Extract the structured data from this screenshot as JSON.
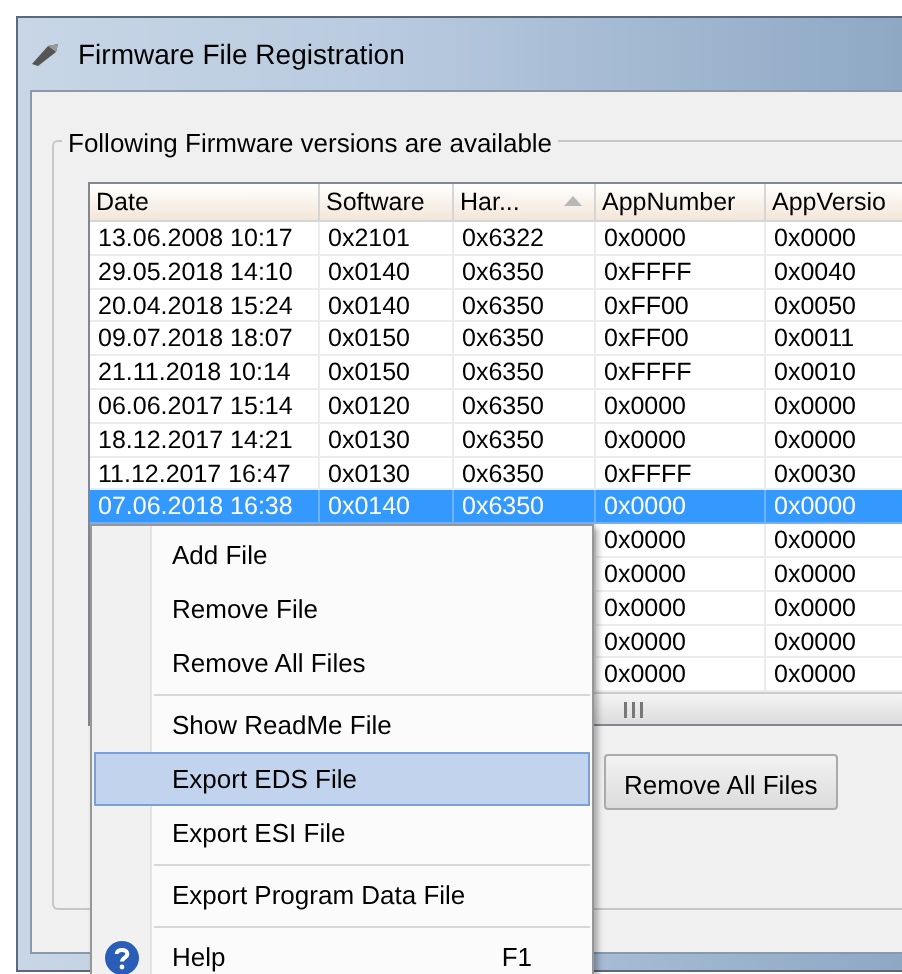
{
  "window": {
    "title": "Firmware File Registration"
  },
  "group": {
    "label": "Following Firmware versions are available"
  },
  "table": {
    "columns": [
      {
        "label": "Date",
        "sorted": false
      },
      {
        "label": "Software",
        "sorted": false
      },
      {
        "label": "Har...",
        "sorted": true
      },
      {
        "label": "AppNumber",
        "sorted": false
      },
      {
        "label": "AppVersio",
        "sorted": false
      }
    ],
    "rows": [
      {
        "selected": false,
        "cells": [
          "13.06.2008 10:17",
          "0x2101",
          "0x6322",
          "0x0000",
          "0x0000"
        ]
      },
      {
        "selected": false,
        "cells": [
          "29.05.2018 14:10",
          "0x0140",
          "0x6350",
          "0xFFFF",
          "0x0040"
        ]
      },
      {
        "selected": false,
        "cells": [
          "20.04.2018 15:24",
          "0x0140",
          "0x6350",
          "0xFF00",
          "0x0050"
        ]
      },
      {
        "selected": false,
        "cells": [
          "09.07.2018 18:07",
          "0x0150",
          "0x6350",
          "0xFF00",
          "0x0011"
        ]
      },
      {
        "selected": false,
        "cells": [
          "21.11.2018 10:14",
          "0x0150",
          "0x6350",
          "0xFFFF",
          "0x0010"
        ]
      },
      {
        "selected": false,
        "cells": [
          "06.06.2017 15:14",
          "0x0120",
          "0x6350",
          "0x0000",
          "0x0000"
        ]
      },
      {
        "selected": false,
        "cells": [
          "18.12.2017 14:21",
          "0x0130",
          "0x6350",
          "0x0000",
          "0x0000"
        ]
      },
      {
        "selected": false,
        "cells": [
          "11.12.2017 16:47",
          "0x0130",
          "0x6350",
          "0xFFFF",
          "0x0030"
        ]
      },
      {
        "selected": true,
        "cells": [
          "07.06.2018 16:38",
          "0x0140",
          "0x6350",
          "0x0000",
          "0x0000"
        ]
      },
      {
        "selected": false,
        "cells": [
          null,
          null,
          null,
          "0x0000",
          "0x0000"
        ]
      },
      {
        "selected": false,
        "cells": [
          null,
          null,
          null,
          "0x0000",
          "0x0000"
        ]
      },
      {
        "selected": false,
        "cells": [
          null,
          null,
          null,
          "0x0000",
          "0x0000"
        ]
      },
      {
        "selected": false,
        "cells": [
          null,
          null,
          null,
          "0x0000",
          "0x0000"
        ]
      },
      {
        "selected": false,
        "cells": [
          null,
          null,
          null,
          "0x0000",
          "0x0000"
        ]
      }
    ]
  },
  "buttons": [
    {
      "label": "Remove All Files"
    }
  ],
  "context_menu": [
    {
      "kind": "item",
      "label": "Add File",
      "highlighted": false
    },
    {
      "kind": "item",
      "label": "Remove File",
      "highlighted": false
    },
    {
      "kind": "item",
      "label": "Remove All Files",
      "highlighted": false
    },
    {
      "kind": "separator"
    },
    {
      "kind": "item",
      "label": "Show ReadMe File",
      "highlighted": false
    },
    {
      "kind": "item",
      "label": "Export EDS File",
      "highlighted": true
    },
    {
      "kind": "item",
      "label": "Export ESI File",
      "highlighted": false
    },
    {
      "kind": "separator"
    },
    {
      "kind": "item",
      "label": "Export Program Data File",
      "highlighted": false
    },
    {
      "kind": "separator"
    },
    {
      "kind": "help",
      "label": "Help",
      "shortcut": "F1",
      "highlighted": false
    }
  ]
}
